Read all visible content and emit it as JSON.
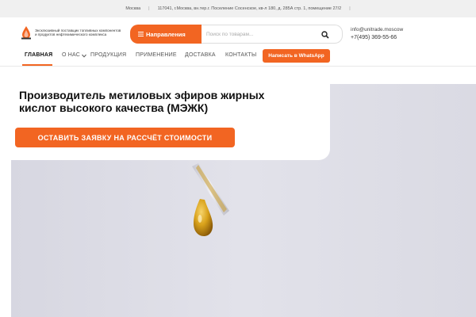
{
  "topbar": {
    "city": "Москва",
    "separator": "|",
    "address": "117041, г.Москва, вн.тер.г. Поселение Сосенское, кв-л 180, д. 285А стр. 1, помещение 27/2"
  },
  "header": {
    "logo_text": "Эксклюзивный поставщик топливных компонентов и продуктов нефтехимического комплекса",
    "directions_label": "Направления",
    "search_placeholder": "Поиск по товарам...",
    "email": "info@unitrade.moscow",
    "phone": "+7(495) 369-55-66"
  },
  "nav": {
    "items": [
      {
        "label": "ГЛАВНАЯ"
      },
      {
        "label": "О НАС"
      },
      {
        "label": "ПРОДУКЦИЯ"
      },
      {
        "label": "ПРИМЕНЕНИЕ"
      },
      {
        "label": "ДОСТАВКА"
      },
      {
        "label": "КОНТАКТЫ"
      }
    ],
    "whatsapp_label": "Написать в WhatsApp"
  },
  "hero": {
    "title": "Производитель метиловых эфиров жирных кислот высокого качества (МЭЖК)",
    "cta_label": "ОСТАВИТЬ ЗАЯВКУ НА РАССЧЁТ СТОИМОСТИ"
  },
  "colors": {
    "accent": "#f26522",
    "hero_bg": "#dcdce6",
    "oil": "#d9a21b"
  }
}
